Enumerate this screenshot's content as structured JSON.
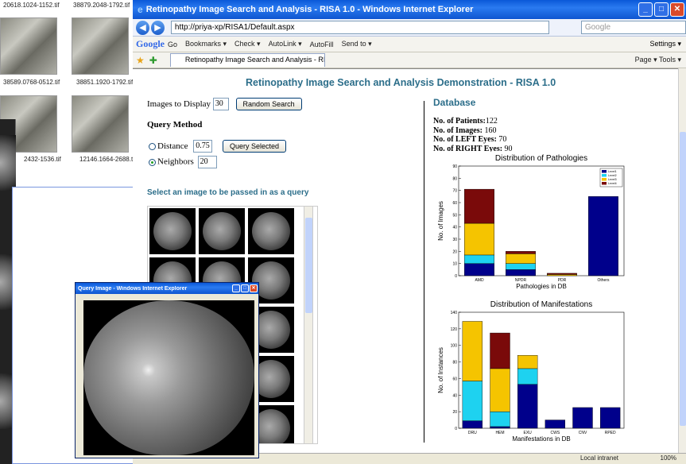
{
  "bg_explorer": {
    "labels": [
      "20618.1024-1152.tif",
      "38879.2048-1792.tif",
      "38589.0768-0512.tif",
      "38851.1920-1792.tif",
      "2432-1536.tif",
      "12146.1664-2688.tif"
    ]
  },
  "ie": {
    "title": "Retinopathy Image Search and Analysis - RISA 1.0 - Windows Internet Explorer",
    "address": "http://priya-xp/RISA1/Default.aspx",
    "search_placeholder": "Google",
    "google_bar": {
      "logo": "Google",
      "items": [
        "Go",
        "Bookmarks ▾",
        "Check ▾",
        "AutoLink ▾",
        "AutoFill",
        "Send to ▾"
      ],
      "settings": "Settings ▾"
    },
    "tab_title": "Retinopathy Image Search and Analysis - RISA 1.0",
    "tools": "Page ▾  Tools ▾",
    "status_zone": "Local intranet",
    "status_zoom": "100%"
  },
  "page": {
    "title": "Retinopathy Image Search and Analysis Demonstration - RISA 1.0",
    "images_to_display_label": "Images to Display",
    "images_to_display_value": "30",
    "random_search_label": "Random Search",
    "query_method_label": "Query Method",
    "distance_label": "Distance",
    "distance_value": "0.75",
    "neighbors_label": "Neighbors",
    "neighbors_value": "20",
    "query_selected_label": "Query Selected",
    "select_prompt": "Select an image to be passed in as a query"
  },
  "database": {
    "heading": "Database",
    "patients_label": "No. of Patients:",
    "patients_value": "122",
    "images_label": "No. of Images:",
    "images_value": "160",
    "left_label": "No. of LEFT Eyes:",
    "left_value": "70",
    "right_label": "No. of RIGHT Eyes:",
    "right_value": "90"
  },
  "popup": {
    "title": "Query Image - Windows Internet Explorer"
  },
  "chart_data": [
    {
      "type": "bar",
      "stacked": true,
      "title": "Distribution of Pathologies",
      "xlabel": "Pathologies in DB",
      "ylabel": "No. of Images",
      "categories": [
        "AMD",
        "NPDR",
        "PDR",
        "Others"
      ],
      "ylim": [
        0,
        90
      ],
      "yticks": [
        0,
        10,
        20,
        30,
        40,
        50,
        60,
        70,
        80,
        90
      ],
      "legend": "top-right",
      "series": [
        {
          "name": "Level1",
          "color": "#00008b",
          "values": [
            10,
            5,
            0,
            65
          ]
        },
        {
          "name": "Level2",
          "color": "#1ed2f0",
          "values": [
            7,
            5,
            0,
            0
          ]
        },
        {
          "name": "Level3",
          "color": "#f5c400",
          "values": [
            26,
            8,
            1,
            0
          ]
        },
        {
          "name": "Level4",
          "color": "#7a0a0a",
          "values": [
            28,
            2,
            1,
            0
          ]
        }
      ]
    },
    {
      "type": "bar",
      "stacked": true,
      "title": "Distribution of Manifestations",
      "xlabel": "Manifestations in DB",
      "ylabel": "No. of Instances",
      "categories": [
        "DRU",
        "HEM",
        "EXU",
        "CWS",
        "CNV",
        "RPED"
      ],
      "ylim": [
        0,
        140
      ],
      "yticks": [
        0,
        20,
        40,
        60,
        80,
        100,
        120,
        140
      ],
      "series": [
        {
          "color": "#00008b",
          "values": [
            9,
            2,
            53,
            10,
            25,
            25
          ]
        },
        {
          "color": "#1ed2f0",
          "values": [
            48,
            18,
            19,
            0,
            0,
            0
          ]
        },
        {
          "color": "#f5c400",
          "values": [
            72,
            52,
            16,
            0,
            0,
            0
          ]
        },
        {
          "color": "#7a0a0a",
          "values": [
            0,
            43,
            0,
            0,
            0,
            0
          ]
        }
      ]
    }
  ]
}
